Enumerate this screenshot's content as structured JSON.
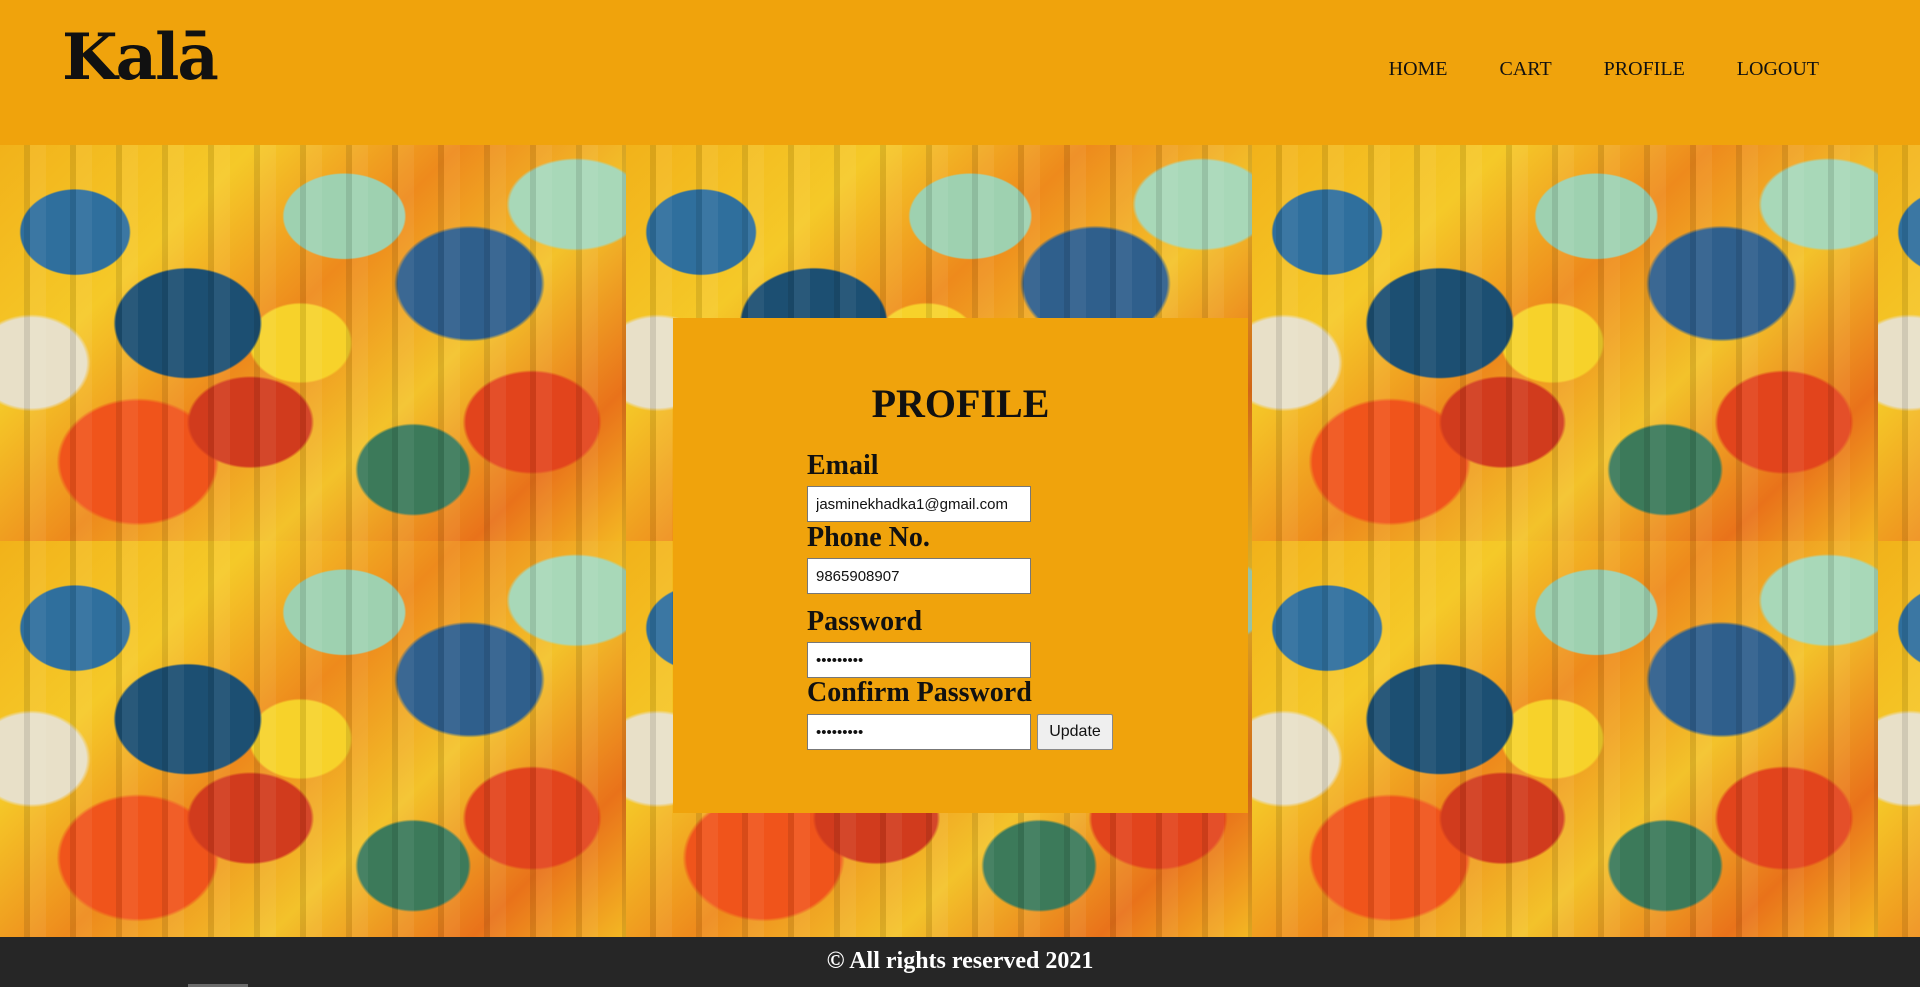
{
  "brand": {
    "logo_text": "Kalā"
  },
  "nav": {
    "items": [
      {
        "label": "HOME"
      },
      {
        "label": "CART"
      },
      {
        "label": "PROFILE"
      },
      {
        "label": "LOGOUT"
      }
    ]
  },
  "profile_form": {
    "title": "PROFILE",
    "email_label": "Email",
    "email_value": "jasminekhadka1@gmail.com",
    "phone_label": "Phone No.",
    "phone_value": "9865908907",
    "password_label": "Password",
    "password_value": "•••••••••",
    "confirm_label": "Confirm Password",
    "confirm_value": "•••••••••",
    "update_label": "Update"
  },
  "footer": {
    "text": "© All rights reserved 2021"
  },
  "colors": {
    "header_bg": "#f0a30c",
    "card_bg": "#f0a30c",
    "footer_bg": "#262626"
  }
}
